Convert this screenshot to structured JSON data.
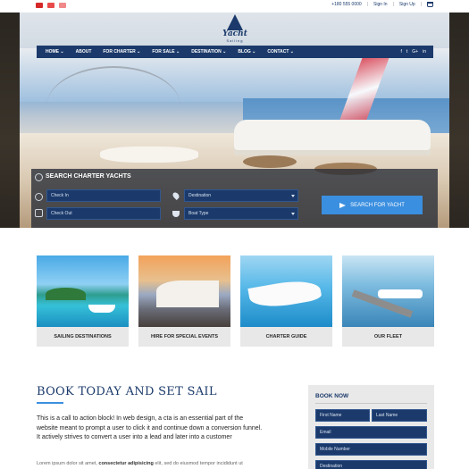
{
  "topbar": {
    "phone": "+180 555 0000",
    "sign_in": "Sign In",
    "sign_up": "Sign Up",
    "flag_colors": [
      "#d62828",
      "#2b6cd4",
      "#e94b4b"
    ]
  },
  "logo": {
    "name": "Yacht",
    "sub": "Sailing"
  },
  "nav": {
    "items": [
      "HOME ⌄",
      "ABOUT",
      "FOR CHARTER ⌄",
      "FOR SALE ⌄",
      "DESTINATION ⌄",
      "BLOG ⌄",
      "CONTACT ⌄"
    ],
    "social": [
      "f",
      "t",
      "G+",
      "in"
    ]
  },
  "search": {
    "title": "SEARCH CHARTER YACHTS",
    "check_in": "Check In",
    "check_out": "Check Out",
    "destination": "Destination",
    "boat_type": "Boat Type",
    "button": "SEARCH FOR YACHT"
  },
  "cards": [
    {
      "label": "SAILING DESTINATIONS"
    },
    {
      "label": "HIRE FOR SPECIAL EVENTS"
    },
    {
      "label": "CHARTER GUIDE"
    },
    {
      "label": "OUR FLEET"
    }
  ],
  "cta": {
    "title": "BOOK TODAY AND SET SAIL",
    "paragraph": "This is a call to action block! In web design, a cta is an essential part of the website meant to prompt a user to click it and continue down a conversion funnel. It actively strives to convert a user into a lead and later into a customer",
    "lorem_start": "Lorem ipsum dolor sit amet, ",
    "lorem_bold": "consectetur adipisicing",
    "lorem_end": " elit, sed do eiusmod tempor incididunt ut"
  },
  "booknow": {
    "title": "BOOK NOW",
    "first_name": "First Name",
    "last_name": "Last Name",
    "email": "Email",
    "mobile": "Mobile Number",
    "destination": "Destination"
  },
  "colors": {
    "brand": "#1b3a6b",
    "accent": "#3b8fe0"
  }
}
